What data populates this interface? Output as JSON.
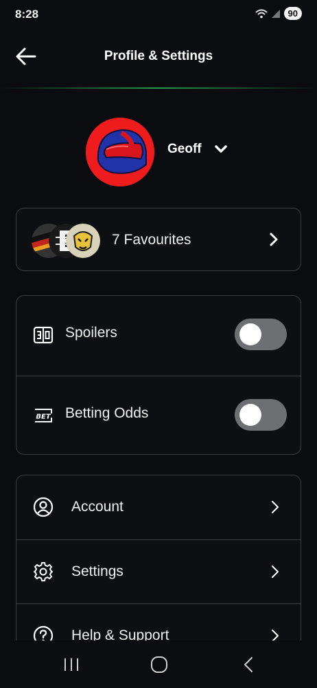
{
  "status_bar": {
    "time": "8:28",
    "battery": "90",
    "icons": [
      "wifi-icon",
      "signal-icon",
      "battery-icon"
    ]
  },
  "header": {
    "title": "Profile & Settings",
    "back_icon": "arrow-left-icon",
    "accent_color": "#2bbf5e"
  },
  "profile": {
    "name": "Geoff",
    "avatar_icon": "helmet-icon",
    "avatar_color": "#ee1c1c",
    "dropdown_icon": "chevron-down-icon"
  },
  "favourites": {
    "label": "7 Favourites",
    "logos": [
      "team-logo-1",
      "team-logo-2",
      "team-logo-3"
    ]
  },
  "toggles": [
    {
      "label": "Spoilers",
      "icon": "scoreboard-icon",
      "enabled": false
    },
    {
      "label": "Betting Odds",
      "icon": "bet-icon",
      "enabled": false
    }
  ],
  "menu": [
    {
      "label": "Account",
      "icon": "user-circle-icon"
    },
    {
      "label": "Settings",
      "icon": "gear-icon"
    },
    {
      "label": "Help & Support",
      "icon": "help-circle-icon"
    }
  ],
  "nav_bar": {
    "buttons": [
      "recents-icon",
      "home-icon",
      "back-icon"
    ]
  }
}
